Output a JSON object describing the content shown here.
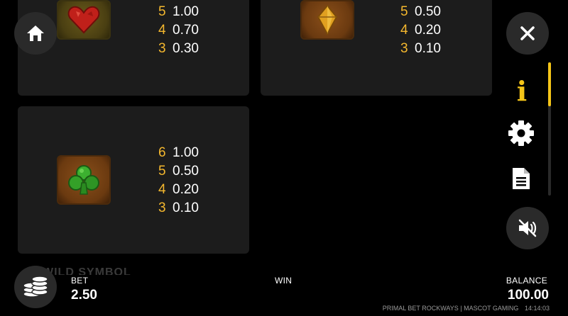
{
  "paytables": [
    {
      "symbol": "ruby-heart-icon",
      "rows": [
        {
          "count": "5",
          "value": "1.00"
        },
        {
          "count": "4",
          "value": "0.70"
        },
        {
          "count": "3",
          "value": "0.30"
        }
      ]
    },
    {
      "symbol": "amber-diamond-icon",
      "rows": [
        {
          "count": "5",
          "value": "0.50"
        },
        {
          "count": "4",
          "value": "0.20"
        },
        {
          "count": "3",
          "value": "0.10"
        }
      ]
    },
    {
      "symbol": "emerald-club-icon",
      "rows": [
        {
          "count": "6",
          "value": "1.00"
        },
        {
          "count": "5",
          "value": "0.50"
        },
        {
          "count": "4",
          "value": "0.20"
        },
        {
          "count": "3",
          "value": "0.10"
        }
      ]
    }
  ],
  "section_heading_partial": "WILD SYMBOL",
  "side_menu": {
    "info_glyph": "i",
    "active": "info"
  },
  "bottom_bar": {
    "bet_label": "BET",
    "bet_value": "2.50",
    "win_label": "WIN",
    "balance_label": "BALANCE",
    "balance_value": "100.00"
  },
  "footer": {
    "game_info": "PRIMAL BET ROCKWAYS | MASCOT GAMING",
    "clock": "14:14:03"
  },
  "colors": {
    "accent": "#f5c518",
    "count": "#f5b82e",
    "panel": "#1c1c1c",
    "button": "#2a2a2a"
  }
}
